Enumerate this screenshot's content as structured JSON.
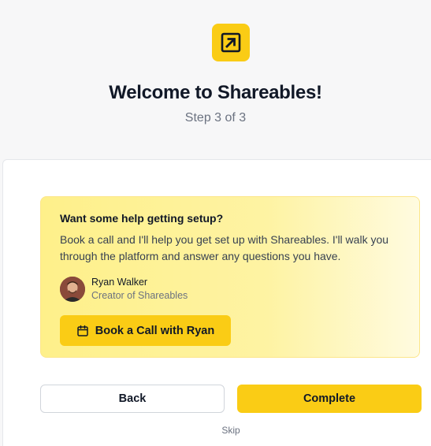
{
  "header": {
    "logo_icon": "arrow-up-right-square-icon",
    "title": "Welcome to Shareables!",
    "step": "Step 3 of 3"
  },
  "help": {
    "title": "Want some help getting setup?",
    "text": "Book a call and I'll help you get set up with Shareables. I'll walk you through the platform and answer any questions you have.",
    "person": {
      "name": "Ryan Walker",
      "role": "Creator of Shareables"
    },
    "book_button": {
      "icon": "calendar-icon",
      "label": "Book a Call with Ryan"
    }
  },
  "actions": {
    "back_label": "Back",
    "complete_label": "Complete",
    "skip_label": "Skip"
  },
  "colors": {
    "accent": "#facc15",
    "help_bg": "#fef08a",
    "muted_text": "#6b7280"
  }
}
